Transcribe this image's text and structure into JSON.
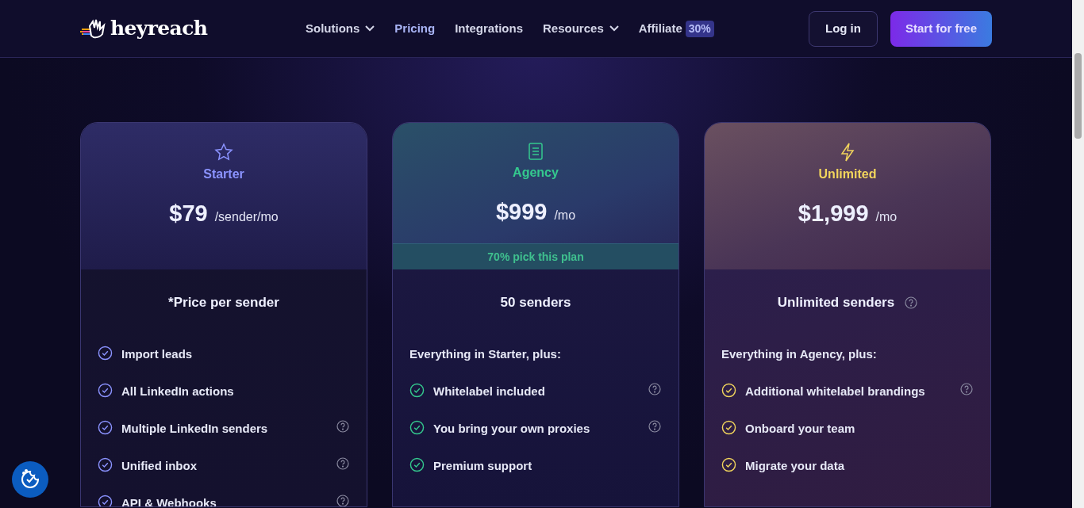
{
  "header": {
    "logo": "heyreach",
    "nav": [
      {
        "label": "Solutions",
        "selected": false,
        "dropdown": true
      },
      {
        "label": "Pricing",
        "selected": true,
        "dropdown": false
      },
      {
        "label": "Integrations",
        "selected": false,
        "dropdown": false
      },
      {
        "label": "Resources",
        "selected": false,
        "dropdown": true
      },
      {
        "label": "Affiliate",
        "selected": false,
        "dropdown": false,
        "badge": "30%"
      }
    ],
    "login": "Log in",
    "cta": "Start for free"
  },
  "plans": [
    {
      "name": "Starter",
      "color": "#8b93ff",
      "price": "$79",
      "period": "/sender/mo",
      "subtitle": "*Price per sender",
      "subtitle_help": false,
      "features": [
        {
          "label": "Import leads",
          "help": false
        },
        {
          "label": "All LinkedIn actions",
          "help": false
        },
        {
          "label": "Multiple LinkedIn senders",
          "help": true
        },
        {
          "label": "Unified inbox",
          "help": true
        },
        {
          "label": "API & Webhooks",
          "help": true
        }
      ]
    },
    {
      "name": "Agency",
      "color": "#34c98e",
      "price": "$999",
      "period": "/mo",
      "highlight": "70% pick this plan",
      "subtitle": "50 senders",
      "subtitle_help": false,
      "intro": "Everything in Starter, plus:",
      "features": [
        {
          "label": "Whitelabel included",
          "help": true
        },
        {
          "label": "You bring your own proxies",
          "help": true
        },
        {
          "label": "Premium support",
          "help": false
        }
      ]
    },
    {
      "name": "Unlimited",
      "color": "#f2d55c",
      "price": "$1,999",
      "period": "/mo",
      "subtitle": "Unlimited senders",
      "subtitle_help": true,
      "intro": "Everything in Agency, plus:",
      "features": [
        {
          "label": "Additional whitelabel brandings",
          "help": true
        },
        {
          "label": "Onboard your team",
          "help": false
        },
        {
          "label": "Migrate your data",
          "help": false
        }
      ]
    }
  ]
}
